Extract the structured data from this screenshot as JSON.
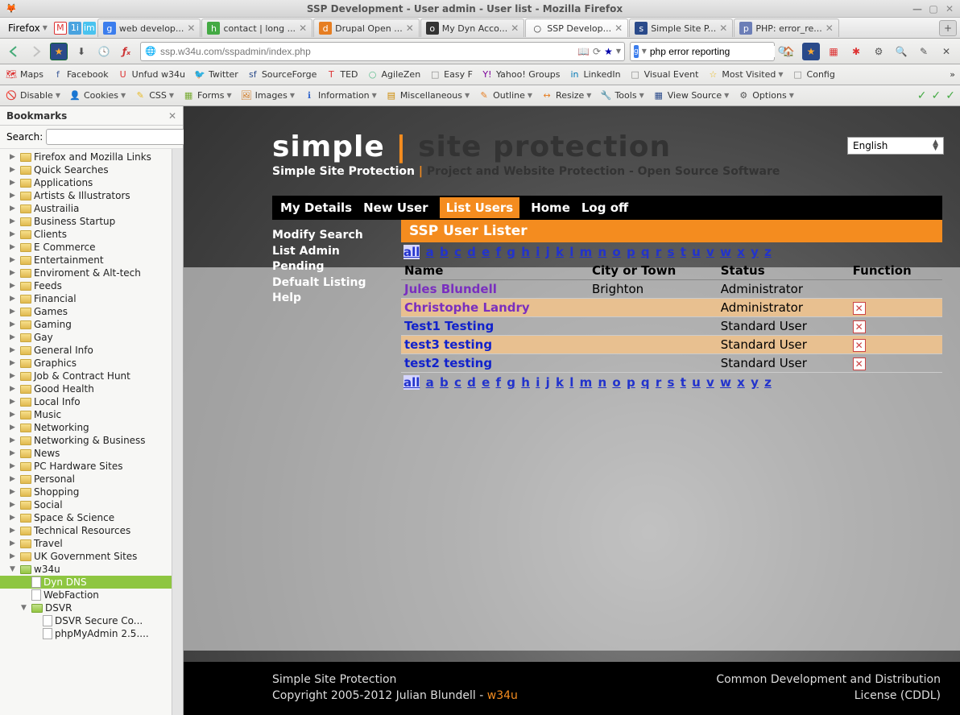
{
  "window_title": "SSP Development - User admin - User list - Mozilla Firefox",
  "firefox_label": "Firefox",
  "tabs": [
    {
      "label": "web develop...",
      "icon": "g"
    },
    {
      "label": "contact | long ...",
      "icon": "h"
    },
    {
      "label": "Drupal Open ...",
      "icon": "d"
    },
    {
      "label": "My Dyn Acco...",
      "icon": "o"
    },
    {
      "label": "SSP Develop...",
      "icon": "",
      "active": true
    },
    {
      "label": "Simple Site P...",
      "icon": "sf"
    },
    {
      "label": "PHP: error_re...",
      "icon": "php"
    }
  ],
  "url": "ssp.w34u.com/sspadmin/index.php",
  "search_placeholder": "php error reporting",
  "bookmark_toolbar": [
    "Maps",
    "Facebook",
    "Unfud w34u",
    "Twitter",
    "SourceForge",
    "TED",
    "AgileZen",
    "Easy F",
    "Yahoo! Groups",
    "LinkedIn",
    "Visual Event",
    "Most Visited",
    "Config"
  ],
  "webdev": [
    "Disable",
    "Cookies",
    "CSS",
    "Forms",
    "Images",
    "Information",
    "Miscellaneous",
    "Outline",
    "Resize",
    "Tools",
    "View Source",
    "Options"
  ],
  "sidebar": {
    "title": "Bookmarks",
    "search_label": "Search:",
    "tree": [
      {
        "label": "Firefox and Mozilla Links",
        "type": "folder"
      },
      {
        "label": "Quick Searches",
        "type": "folder"
      },
      {
        "label": "Applications",
        "type": "folder"
      },
      {
        "label": "Artists & Illustrators",
        "type": "folder"
      },
      {
        "label": "Austrailia",
        "type": "folder"
      },
      {
        "label": "Business Startup",
        "type": "folder"
      },
      {
        "label": "Clients",
        "type": "folder"
      },
      {
        "label": "E Commerce",
        "type": "folder"
      },
      {
        "label": "Entertainment",
        "type": "folder"
      },
      {
        "label": "Enviroment & Alt-tech",
        "type": "folder"
      },
      {
        "label": "Feeds",
        "type": "folder"
      },
      {
        "label": "Financial",
        "type": "folder"
      },
      {
        "label": "Games",
        "type": "folder"
      },
      {
        "label": "Gaming",
        "type": "folder"
      },
      {
        "label": "Gay",
        "type": "folder"
      },
      {
        "label": "General Info",
        "type": "folder"
      },
      {
        "label": "Graphics",
        "type": "folder"
      },
      {
        "label": "Job & Contract Hunt",
        "type": "folder"
      },
      {
        "label": "Good Health",
        "type": "folder"
      },
      {
        "label": "Local Info",
        "type": "folder"
      },
      {
        "label": "Music",
        "type": "folder"
      },
      {
        "label": "Networking",
        "type": "folder"
      },
      {
        "label": "Networking & Business",
        "type": "folder"
      },
      {
        "label": "News",
        "type": "folder"
      },
      {
        "label": "PC Hardware Sites",
        "type": "folder"
      },
      {
        "label": "Personal",
        "type": "folder"
      },
      {
        "label": "Shopping",
        "type": "folder"
      },
      {
        "label": "Social",
        "type": "folder"
      },
      {
        "label": "Space & Science",
        "type": "folder"
      },
      {
        "label": "Technical Resources",
        "type": "folder"
      },
      {
        "label": "Travel",
        "type": "folder"
      },
      {
        "label": "UK Government Sites",
        "type": "folder"
      },
      {
        "label": "w34u",
        "type": "folder-open",
        "children": [
          {
            "label": "Dyn DNS",
            "type": "leaf",
            "selected": true
          },
          {
            "label": "WebFaction",
            "type": "leaf"
          },
          {
            "label": "DSVR",
            "type": "folder-open",
            "children": [
              {
                "label": "DSVR Secure Co...",
                "type": "leaf"
              },
              {
                "label": "phpMyAdmin 2.5....",
                "type": "leaf"
              }
            ]
          }
        ]
      }
    ]
  },
  "page": {
    "brand1": "simple",
    "brand_sep": "|",
    "brand2": "site protection",
    "tagline_a": "Simple Site Protection",
    "tagline_sep": " | ",
    "tagline_b": "Project and Website Protection - Open Source Software",
    "lang": "English",
    "menu": [
      "My Details",
      "New User",
      "List Users",
      "Home",
      "Log off"
    ],
    "menu_active": 2,
    "side_menu": [
      "Modify Search",
      "List Admin Pending",
      "Defualt Listing",
      "Help"
    ],
    "panel_title": "SSP User Lister",
    "alpha": [
      "all",
      "a",
      "b",
      "c",
      "d",
      "e",
      "f",
      "g",
      "h",
      "i",
      "j",
      "k",
      "l",
      "m",
      "n",
      "o",
      "p",
      "q",
      "r",
      "s",
      "t",
      "u",
      "v",
      "w",
      "x",
      "y",
      "z"
    ],
    "columns": [
      "Name",
      "City or Town",
      "Status",
      "Function"
    ],
    "users": [
      {
        "name": "Jules Blundell",
        "city": "Brighton",
        "status": "Administrator",
        "del": false,
        "color": "purple"
      },
      {
        "name": "Christophe Landry",
        "city": "",
        "status": "Administrator",
        "del": true,
        "color": "purple"
      },
      {
        "name": "Test1 Testing",
        "city": "",
        "status": "Standard User",
        "del": true,
        "color": "blue"
      },
      {
        "name": "test3 testing",
        "city": "",
        "status": "Standard User",
        "del": true,
        "color": "blue"
      },
      {
        "name": "test2 testing",
        "city": "",
        "status": "Standard User",
        "del": true,
        "color": "blue"
      }
    ],
    "footer_left1": "Simple Site Protection",
    "footer_left2": "Copyright 2005-2012 Julian Blundell - ",
    "footer_left_link": "w34u",
    "footer_right1": "Common Development and Distribution",
    "footer_right2": "License (CDDL)"
  }
}
